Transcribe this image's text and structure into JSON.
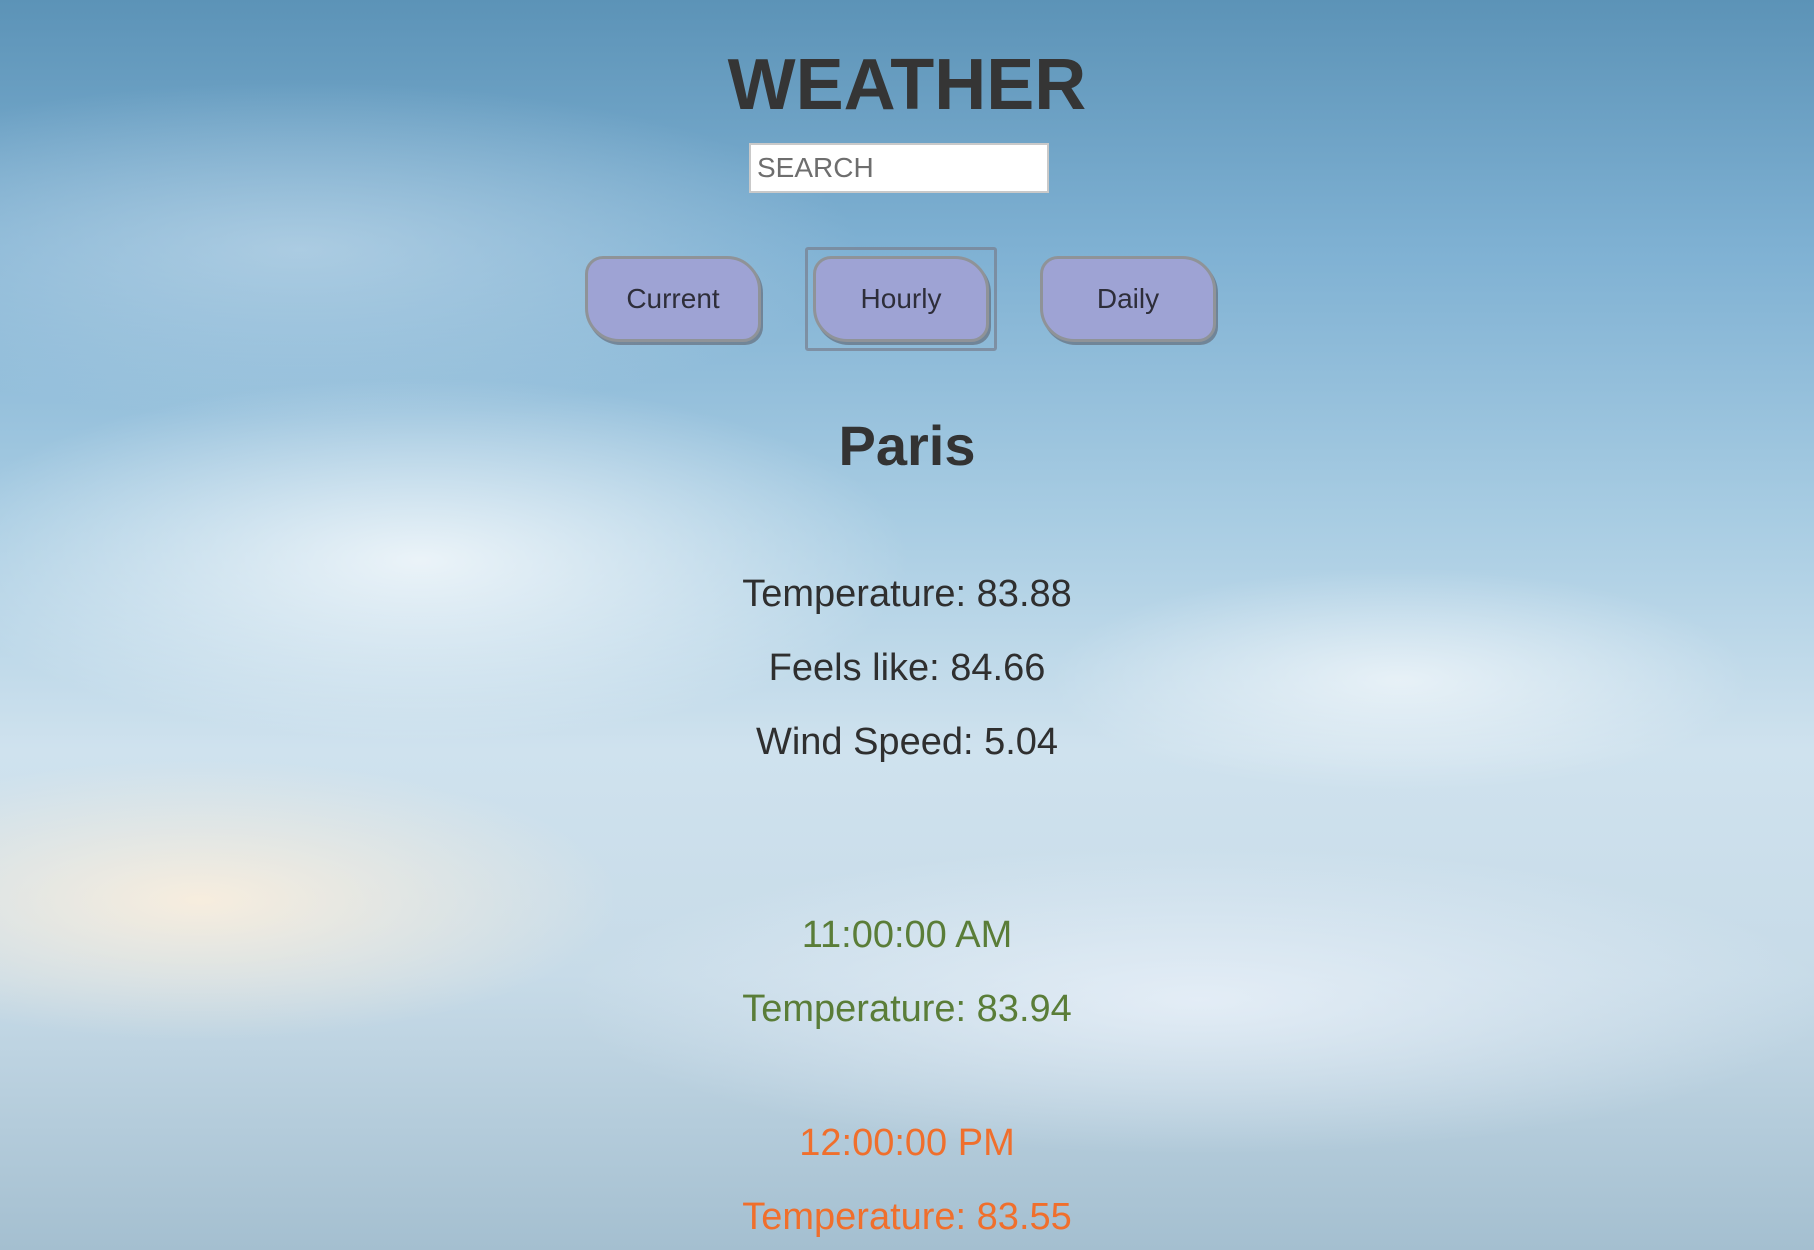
{
  "header": {
    "title": "WEATHER"
  },
  "search": {
    "placeholder": "SEARCH",
    "value": ""
  },
  "tabs": [
    {
      "label": "Current"
    },
    {
      "label": "Hourly"
    },
    {
      "label": "Daily"
    }
  ],
  "selected_tab": "Hourly",
  "location": {
    "city": "Paris"
  },
  "current": {
    "temperature": "Temperature: 83.88",
    "feels_like": "Feels like: 84.66",
    "wind_speed": "Wind Speed: 5.04"
  },
  "hourly": [
    {
      "time": "11:00:00 AM",
      "temperature": "Temperature: 83.94",
      "color": "#5a7d38"
    },
    {
      "time": "12:00:00 PM",
      "temperature": "Temperature: 83.55",
      "color": "#f06f2c"
    }
  ],
  "colors": {
    "button_fill": "#9ea3d4",
    "title_text": "#353535"
  }
}
